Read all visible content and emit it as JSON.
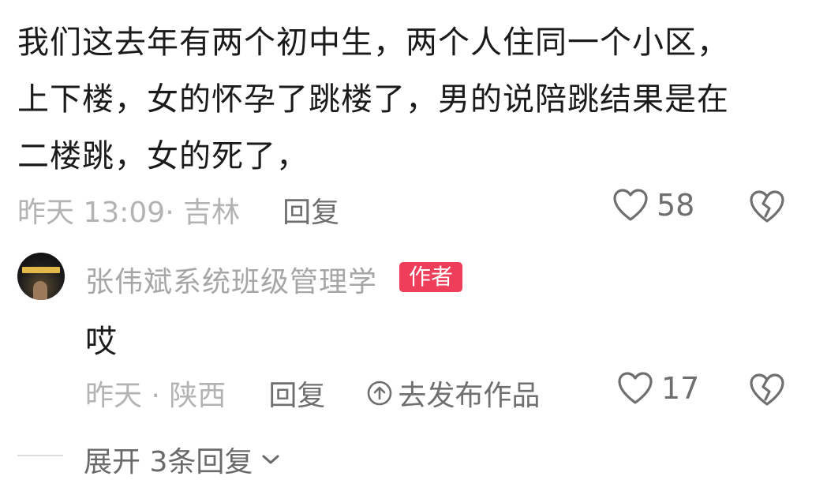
{
  "comment": {
    "lines": [
      "我们这去年有两个初中生，两个人住同一个小区，",
      "上下楼，女的怀孕了跳楼了，男的说陪跳结果是在",
      "二楼跳，女的死了，"
    ],
    "meta": "昨天 13:09· 吉林",
    "reply_label": "回复",
    "like_count": "58"
  },
  "reply": {
    "username": "张伟斌系统班级管理学",
    "badge": "作者",
    "text": "哎",
    "meta": "昨天 · 陕西",
    "reply_label": "回复",
    "publish_label": "去发布作品",
    "like_count": "17"
  },
  "expand": {
    "label": "展开 3条回复"
  },
  "colors": {
    "badge": "#ee3e5a",
    "meta_text": "#b3b3b3",
    "body_text": "#1b1b1b"
  },
  "icons": [
    "heart-icon",
    "broken-heart-icon",
    "upload-icon",
    "chevron-down-icon"
  ]
}
